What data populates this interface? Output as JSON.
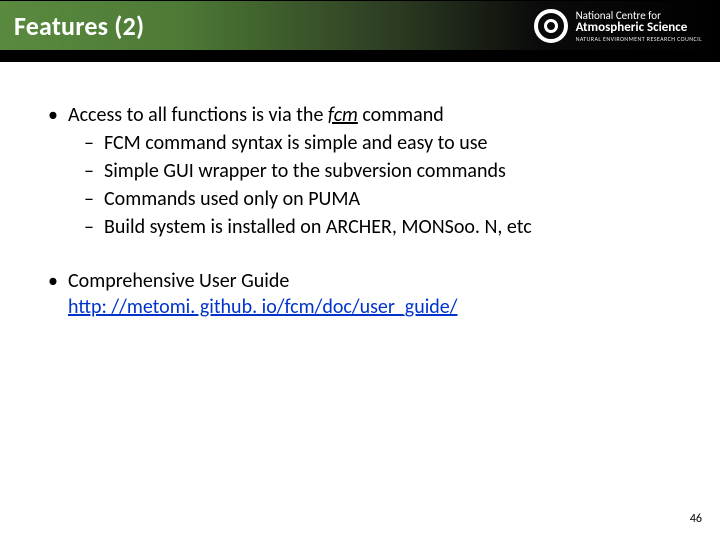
{
  "header": {
    "title": "Features (2)",
    "logo": {
      "line1": "National Centre for",
      "line2": "Atmospheric Science",
      "line3": "NATURAL ENVIRONMENT RESEARCH COUNCIL"
    }
  },
  "body": {
    "item1": {
      "prefix": "Access to all functions is via the ",
      "fcm": "fcm",
      "suffix": " command",
      "subs": {
        "a": "FCM command syntax is simple and easy to use",
        "b": "Simple GUI wrapper to the subversion commands",
        "c": "Commands used only on PUMA",
        "d": "Build system is installed on ARCHER, MONSoo. N, etc"
      }
    },
    "item2": {
      "text": "Comprehensive User Guide",
      "link": "http: //metomi. github. io/fcm/doc/user_guide/"
    }
  },
  "page_number": "46"
}
